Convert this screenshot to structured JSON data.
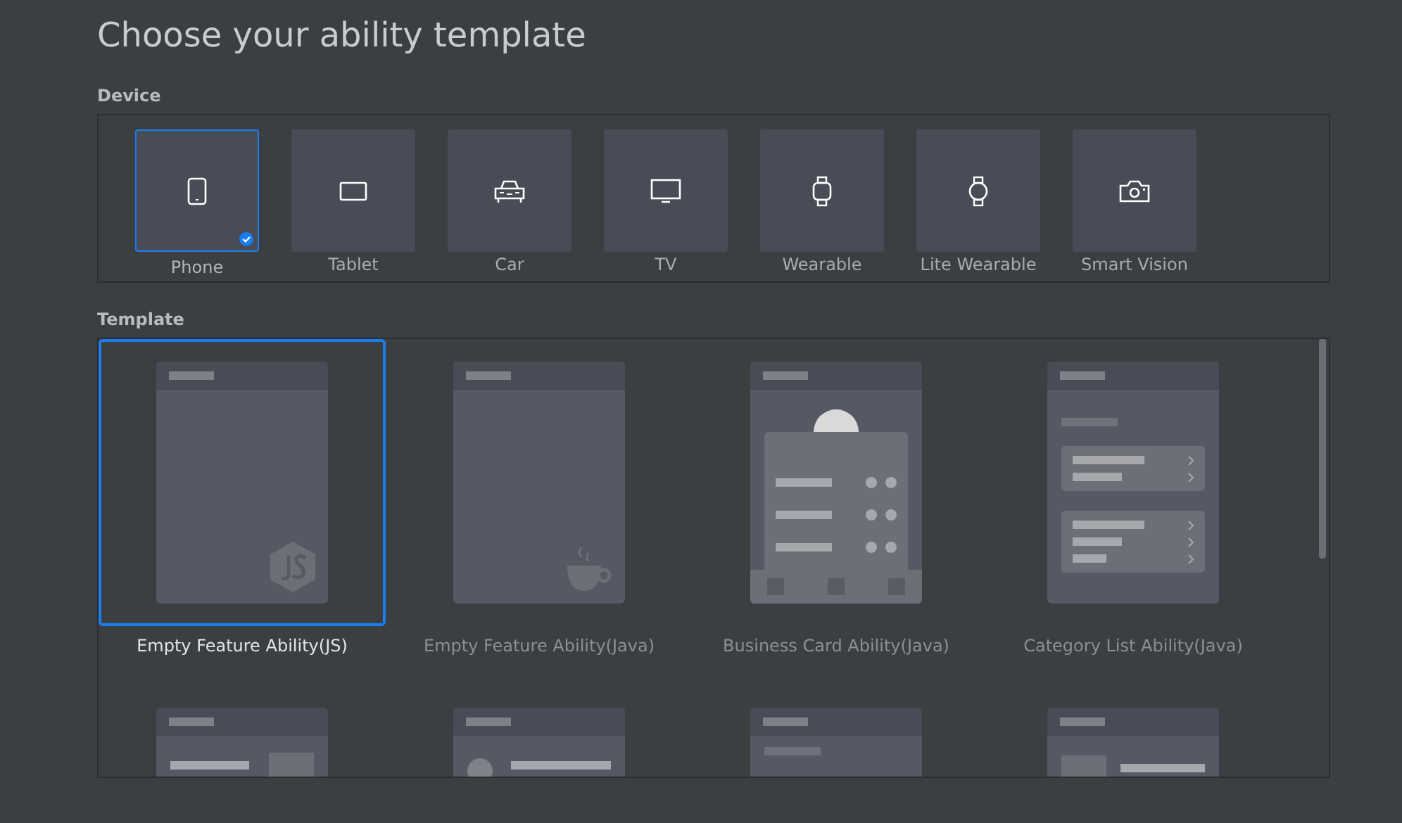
{
  "title": "Choose your ability template",
  "device": {
    "label": "Device",
    "items": [
      {
        "kind": "phone",
        "label": "Phone",
        "selected": true
      },
      {
        "kind": "tablet",
        "label": "Tablet",
        "selected": false
      },
      {
        "kind": "car",
        "label": "Car",
        "selected": false
      },
      {
        "kind": "tv",
        "label": "TV",
        "selected": false
      },
      {
        "kind": "wearable",
        "label": "Wearable",
        "selected": false
      },
      {
        "kind": "lite-wearable",
        "label": "Lite Wearable",
        "selected": false
      },
      {
        "kind": "camera",
        "label": "Smart Vision",
        "selected": false
      }
    ]
  },
  "template": {
    "label": "Template",
    "items": [
      {
        "kind": "js",
        "label": "Empty Feature Ability(JS)",
        "selected": true
      },
      {
        "kind": "java",
        "label": "Empty Feature Ability(Java)",
        "selected": false
      },
      {
        "kind": "business-card",
        "label": "Business Card Ability(Java)",
        "selected": false
      },
      {
        "kind": "category-list",
        "label": "Category List Ability(Java)",
        "selected": false
      },
      {
        "kind": "list-image",
        "selected": false
      },
      {
        "kind": "profile",
        "selected": false
      },
      {
        "kind": "text-list",
        "selected": false
      },
      {
        "kind": "image-list",
        "selected": false
      }
    ]
  }
}
